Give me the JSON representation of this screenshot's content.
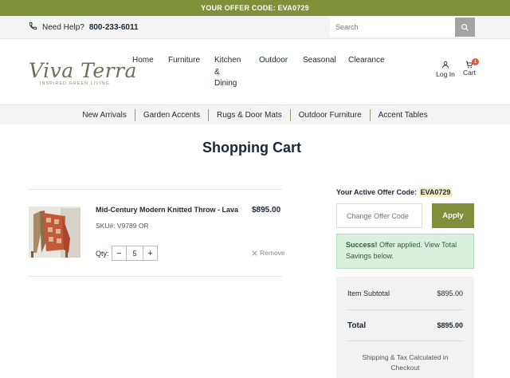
{
  "promo": {
    "text": "YOUR OFFER CODE: EVA0729"
  },
  "help": {
    "label": "Need Help?",
    "phone": "800-233-6011"
  },
  "search": {
    "placeholder": "Search"
  },
  "logo": {
    "main": "Viva Terra",
    "sub": "INSPIRED GREEN LIVING"
  },
  "nav": {
    "items": [
      {
        "label": "Home"
      },
      {
        "label": "Furniture"
      },
      {
        "label": "Kitchen\n&\nDining"
      },
      {
        "label": "Outdoor"
      },
      {
        "label": "Seasonal"
      },
      {
        "label": "Clearance"
      }
    ],
    "login": "Log In",
    "cart": "Cart",
    "cart_count": "1"
  },
  "categories": [
    "New Arrivals",
    "Garden Accents",
    "Rugs & Door Mats",
    "Outdoor Furniture",
    "Accent Tables"
  ],
  "page": {
    "title": "Shopping Cart"
  },
  "cart_item": {
    "name": "Mid-Century Modern Knitted Throw - Lava",
    "price": "$895.00",
    "sku": "SKU#: V9789 OR",
    "qty_label": "Qty:",
    "qty": "5",
    "minus": "−",
    "plus": "+",
    "remove": "Remove"
  },
  "offer": {
    "label": "Your Active Offer Code:",
    "code": "EVA0729",
    "input_placeholder": "Change Offer Code",
    "apply": "Apply",
    "success_title": "Success!",
    "success_text": "Offer applied. View Total Savings below."
  },
  "summary": {
    "subtotal_label": "Item Subtotal",
    "subtotal_value": "$895.00",
    "total_label": "Total",
    "total_value": "$895.00",
    "shipping_note": "Shipping & Tax Calculated in Checkout"
  },
  "colors": {
    "brand_green": "#7f8f3a",
    "badge": "#e05c42",
    "success_bg": "#d8f0dd"
  }
}
